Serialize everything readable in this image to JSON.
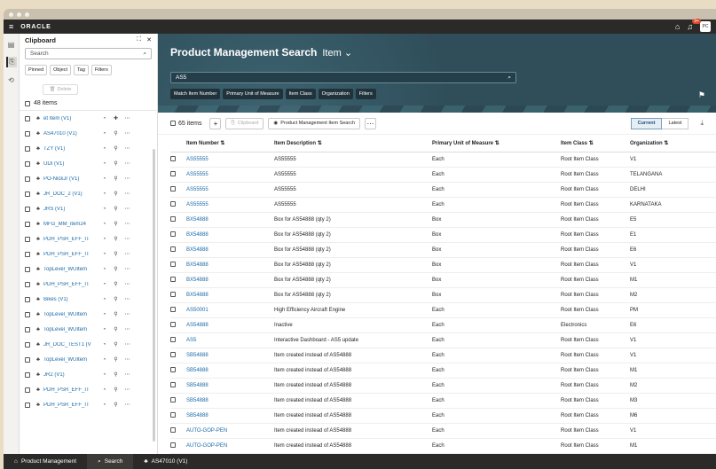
{
  "brand": "ORACLE",
  "topbar": {
    "menu_icon": "hamburger-icon",
    "notification_count": "9+",
    "avatar": "PC"
  },
  "clipboard": {
    "title": "Clipboard",
    "search_placeholder": "Search",
    "filters": [
      "Pinned",
      "Object",
      "Tag",
      "Filters"
    ],
    "delete_label": "Delete",
    "count_label": "48 items",
    "items": [
      {
        "name": "et Item (V1)",
        "pinned": true
      },
      {
        "name": "AS47010 (V1)",
        "pinned": false
      },
      {
        "name": "TZY (V1)",
        "pinned": false
      },
      {
        "name": "UDI (V1)",
        "pinned": false
      },
      {
        "name": "PO-NickJr (V1)",
        "pinned": false
      },
      {
        "name": "JR_DOC_2 (V1)",
        "pinned": false
      },
      {
        "name": "JRS (V1)",
        "pinned": false
      },
      {
        "name": "MFG_MM_item24",
        "pinned": false
      },
      {
        "name": "PDH_PSR_EFF_IT",
        "pinned": false
      },
      {
        "name": "PDH_PSR_EFF_IT",
        "pinned": false
      },
      {
        "name": "TopLevel_WUItem",
        "pinned": false
      },
      {
        "name": "PDH_PSR_EFF_IT",
        "pinned": false
      },
      {
        "name": "Bikes (V1)",
        "pinned": false
      },
      {
        "name": "TopLevel_WUItem",
        "pinned": false
      },
      {
        "name": "TopLevel_WUItem",
        "pinned": false
      },
      {
        "name": "JR_DOC_TEST1 (V",
        "pinned": false
      },
      {
        "name": "TopLevel_WUItem",
        "pinned": false
      },
      {
        "name": "JR2 (V1)",
        "pinned": false
      },
      {
        "name": "PDH_PSR_EFF_IT",
        "pinned": false
      },
      {
        "name": "PDH_PSR_EFF_IT",
        "pinned": false
      }
    ]
  },
  "search": {
    "title": "Product Management Search",
    "object_select": "Item",
    "query": "AS5",
    "tabs": [
      "Match Item Number",
      "Primary Unit of Measure",
      "Item Class",
      "Organization",
      "Filters"
    ]
  },
  "toolbar": {
    "count_label": "65 items",
    "clipboard_label": "Clipboard",
    "search_label": "Product Management Item Search",
    "current_label": "Current",
    "latest_label": "Latest"
  },
  "table": {
    "headers": [
      "Item Number",
      "Item Description",
      "Primary Unit of Measure",
      "Item Class",
      "Organization"
    ],
    "rows": [
      [
        "AS55555",
        "AS55555",
        "Each",
        "Root Item Class",
        "V1"
      ],
      [
        "AS55555",
        "AS55555",
        "Each",
        "Root Item Class",
        "TELANGANA"
      ],
      [
        "AS55555",
        "AS55555",
        "Each",
        "Root Item Class",
        "DELHI"
      ],
      [
        "AS55555",
        "AS55555",
        "Each",
        "Root Item Class",
        "KARNATAKA"
      ],
      [
        "BX54888",
        "Box for AS54888 (qty 2)",
        "Box",
        "Root Item Class",
        "E5"
      ],
      [
        "BX54888",
        "Box for AS54888 (qty 2)",
        "Box",
        "Root Item Class",
        "E1"
      ],
      [
        "BX54888",
        "Box for AS54888 (qty 2)",
        "Box",
        "Root Item Class",
        "E6"
      ],
      [
        "BX54888",
        "Box for AS54888 (qty 2)",
        "Box",
        "Root Item Class",
        "V1"
      ],
      [
        "BX54888",
        "Box for AS54888 (qty 2)",
        "Box",
        "Root Item Class",
        "M1"
      ],
      [
        "BX54888",
        "Box for AS54888 (qty 2)",
        "Box",
        "Root Item Class",
        "M2"
      ],
      [
        "AS50001",
        "High Efficiency Aircraft Engine",
        "Each",
        "Root Item Class",
        "PM"
      ],
      [
        "AS54888",
        "Inactive",
        "Each",
        "Electronics",
        "E6"
      ],
      [
        "AS5",
        "Interactive Dashboard - AS5 update",
        "Each",
        "Root Item Class",
        "V1"
      ],
      [
        "SB54888",
        "Item created instead of AS54888",
        "Each",
        "Root Item Class",
        "V1"
      ],
      [
        "SB54888",
        "Item created instead of AS54888",
        "Each",
        "Root Item Class",
        "M1"
      ],
      [
        "SB54888",
        "Item created instead of AS54888",
        "Each",
        "Root Item Class",
        "M2"
      ],
      [
        "SB54888",
        "Item created instead of AS54888",
        "Each",
        "Root Item Class",
        "M3"
      ],
      [
        "SB54888",
        "Item created instead of AS54888",
        "Each",
        "Root Item Class",
        "M6"
      ],
      [
        "AUTO-GOP-PEN",
        "Item created instead of AS54888",
        "Each",
        "Root Item Class",
        "V1"
      ],
      [
        "AUTO-GOP-PEN",
        "Item created instead of AS54888",
        "Each",
        "Root Item Class",
        "M1"
      ]
    ]
  },
  "bottombar": {
    "items": [
      "Product Management",
      "Search",
      "AS47010 (V1)"
    ]
  }
}
